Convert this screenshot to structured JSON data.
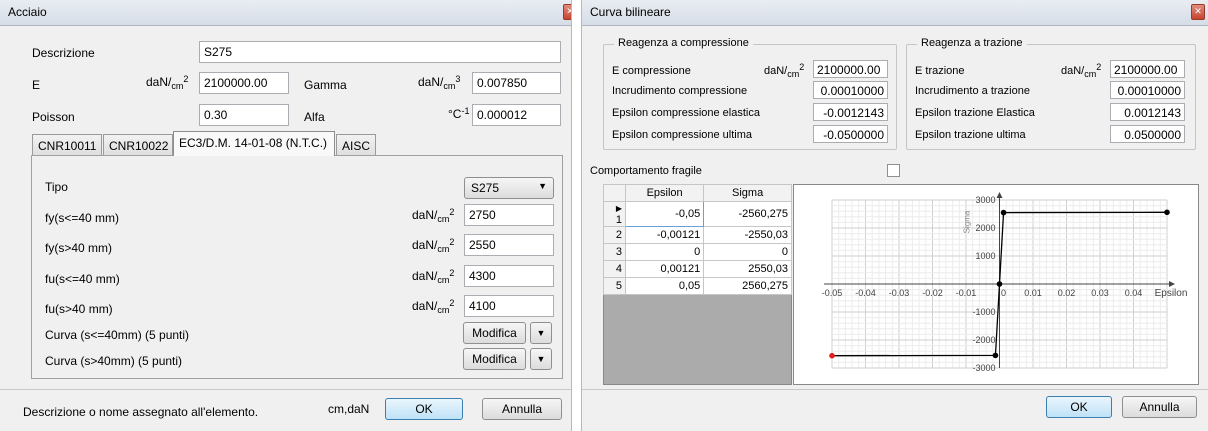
{
  "win1": {
    "title": "Acciaio",
    "descrizione_label": "Descrizione",
    "descrizione_value": "S275",
    "E_label": "E",
    "E_unit": {
      "a": "daN/",
      "b": "cm",
      "c": "2"
    },
    "E_value": "2100000.00",
    "gamma_label": "Gamma",
    "gamma_unit": {
      "a": "daN/",
      "b": "cm",
      "c": "3"
    },
    "gamma_value": "0.007850",
    "poisson_label": "Poisson",
    "poisson_value": "0.30",
    "alfa_label": "Alfa",
    "alfa_unit": {
      "a": "°C",
      "b": "-1"
    },
    "alfa_value": "0.000012",
    "tabs": [
      "CNR10011",
      "CNR10022",
      "EC3/D.M. 14-01-08 (N.T.C.)",
      "AISC"
    ],
    "tipo_label": "Tipo",
    "tipo_value": "S275",
    "fy1_label": "fy(s<=40 mm)",
    "fy1_value": "2750",
    "fy2_label": "fy(s>40 mm)",
    "fy2_value": "2550",
    "fu1_label": "fu(s<=40 mm)",
    "fu1_value": "4300",
    "fu2_label": "fu(s>40 mm)",
    "fu2_value": "4100",
    "f_unit": {
      "a": "daN/",
      "b": "cm",
      "c": "2"
    },
    "curva1_label": "Curva (s<=40mm)  (5 punti)",
    "curva2_label": "Curva (s>40mm)  (5 punti)",
    "modifica": "Modifica",
    "status_text": "Descrizione o nome assegnato all'elemento.",
    "units": "cm,daN",
    "ok": "OK",
    "annulla": "Annulla"
  },
  "win2": {
    "title": "Curva bilineare",
    "compressione": {
      "title": "Reagenza a compressione",
      "e_label": "E compressione",
      "e_unit": {
        "a": "daN/",
        "b": "cm",
        "c": "2"
      },
      "e_value": "2100000.00",
      "incr_label": "Incrudimento compressione",
      "incr_value": "0.00010000",
      "eps_el_label": "Epsilon compressione elastica",
      "eps_el_value": "-0.0012143",
      "eps_ult_label": "Epsilon compressione ultima",
      "eps_ult_value": "-0.0500000"
    },
    "trazione": {
      "title": "Reagenza a trazione",
      "e_label": "E trazione",
      "e_unit": {
        "a": "daN/",
        "b": "cm",
        "c": "2"
      },
      "e_value": "2100000.00",
      "incr_label": "Incrudimento a trazione",
      "incr_value": "0.00010000",
      "eps_el_label": "Epsilon trazione Elastica",
      "eps_el_value": "0.0012143",
      "eps_ult_label": "Epsilon trazione ultima",
      "eps_ult_value": "0.0500000"
    },
    "fragile_label": "Comportamento fragile",
    "table": {
      "headers": [
        "Epsilon",
        "Sigma"
      ],
      "rows": [
        {
          "n": "1",
          "eps": "-0,05",
          "sig": "-2560,275"
        },
        {
          "n": "2",
          "eps": "-0,00121",
          "sig": "-2550,03"
        },
        {
          "n": "3",
          "eps": "0",
          "sig": "0"
        },
        {
          "n": "4",
          "eps": "0,00121",
          "sig": "2550,03"
        },
        {
          "n": "5",
          "eps": "0,05",
          "sig": "2560,275"
        }
      ],
      "current_row_marker": "▶"
    },
    "ok": "OK",
    "annulla": "Annulla"
  },
  "chart_data": {
    "type": "line",
    "x": [
      -0.05,
      -0.00121,
      0,
      0.00121,
      0.05
    ],
    "y": [
      -2560.275,
      -2550.03,
      0,
      2550.03,
      2560.275
    ],
    "xlabel": "Epsilon",
    "ylabel": "Sigma",
    "xlim": [
      -0.05,
      0.05
    ],
    "ylim": [
      -3000,
      3000
    ],
    "xticks": [
      -0.05,
      -0.04,
      -0.03,
      -0.02,
      -0.01,
      0,
      0.01,
      0.02,
      0.03,
      0.04
    ],
    "xtick_labels": [
      "-0.05",
      "-0.04",
      "-0.03",
      "-0.02",
      "-0.01",
      "0",
      "0.01",
      "0.02",
      "0.03",
      "0.04"
    ],
    "yticks": [
      3000,
      2000,
      1000,
      0,
      -1000,
      -2000,
      -3000
    ],
    "ytick_labels": [
      "3000",
      "2000",
      "1000",
      "0",
      "-1000",
      "-2000",
      "-3000"
    ],
    "grid": true,
    "line_color": "#000000",
    "highlight_point_color": "#e0201a",
    "highlight_point_index": 0
  }
}
